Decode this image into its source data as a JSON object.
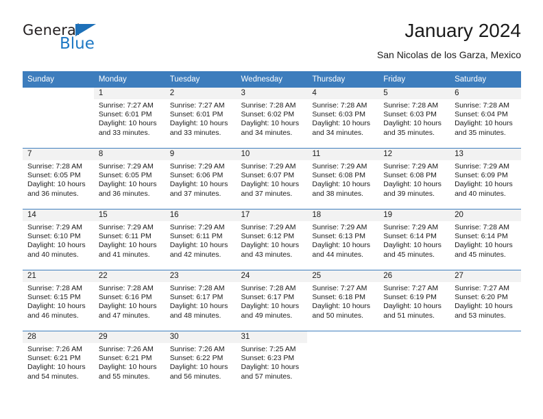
{
  "brand": {
    "name_part1": "General",
    "name_part2": "Blue"
  },
  "header": {
    "title": "January 2024",
    "subtitle": "San Nicolas de los Garza, Mexico"
  },
  "colors": {
    "header_blue": "#3d7dbd",
    "brand_blue": "#1d78c4",
    "daynum_background": "#f2f2f2",
    "text": "#1a1a1a"
  },
  "weekday_headers": [
    "Sunday",
    "Monday",
    "Tuesday",
    "Wednesday",
    "Thursday",
    "Friday",
    "Saturday"
  ],
  "labels": {
    "sunrise_prefix": "Sunrise: ",
    "sunset_prefix": "Sunset: ",
    "daylight_prefix": "Daylight: "
  },
  "weeks": [
    [
      {
        "day": "",
        "sunrise": "",
        "sunset": "",
        "daylight": "",
        "blank": true
      },
      {
        "day": "1",
        "sunrise": "Sunrise: 7:27 AM",
        "sunset": "Sunset: 6:01 PM",
        "daylight": "Daylight: 10 hours and 33 minutes."
      },
      {
        "day": "2",
        "sunrise": "Sunrise: 7:27 AM",
        "sunset": "Sunset: 6:01 PM",
        "daylight": "Daylight: 10 hours and 33 minutes."
      },
      {
        "day": "3",
        "sunrise": "Sunrise: 7:28 AM",
        "sunset": "Sunset: 6:02 PM",
        "daylight": "Daylight: 10 hours and 34 minutes."
      },
      {
        "day": "4",
        "sunrise": "Sunrise: 7:28 AM",
        "sunset": "Sunset: 6:03 PM",
        "daylight": "Daylight: 10 hours and 34 minutes."
      },
      {
        "day": "5",
        "sunrise": "Sunrise: 7:28 AM",
        "sunset": "Sunset: 6:03 PM",
        "daylight": "Daylight: 10 hours and 35 minutes."
      },
      {
        "day": "6",
        "sunrise": "Sunrise: 7:28 AM",
        "sunset": "Sunset: 6:04 PM",
        "daylight": "Daylight: 10 hours and 35 minutes."
      }
    ],
    [
      {
        "day": "7",
        "sunrise": "Sunrise: 7:28 AM",
        "sunset": "Sunset: 6:05 PM",
        "daylight": "Daylight: 10 hours and 36 minutes."
      },
      {
        "day": "8",
        "sunrise": "Sunrise: 7:29 AM",
        "sunset": "Sunset: 6:05 PM",
        "daylight": "Daylight: 10 hours and 36 minutes."
      },
      {
        "day": "9",
        "sunrise": "Sunrise: 7:29 AM",
        "sunset": "Sunset: 6:06 PM",
        "daylight": "Daylight: 10 hours and 37 minutes."
      },
      {
        "day": "10",
        "sunrise": "Sunrise: 7:29 AM",
        "sunset": "Sunset: 6:07 PM",
        "daylight": "Daylight: 10 hours and 37 minutes."
      },
      {
        "day": "11",
        "sunrise": "Sunrise: 7:29 AM",
        "sunset": "Sunset: 6:08 PM",
        "daylight": "Daylight: 10 hours and 38 minutes."
      },
      {
        "day": "12",
        "sunrise": "Sunrise: 7:29 AM",
        "sunset": "Sunset: 6:08 PM",
        "daylight": "Daylight: 10 hours and 39 minutes."
      },
      {
        "day": "13",
        "sunrise": "Sunrise: 7:29 AM",
        "sunset": "Sunset: 6:09 PM",
        "daylight": "Daylight: 10 hours and 40 minutes."
      }
    ],
    [
      {
        "day": "14",
        "sunrise": "Sunrise: 7:29 AM",
        "sunset": "Sunset: 6:10 PM",
        "daylight": "Daylight: 10 hours and 40 minutes."
      },
      {
        "day": "15",
        "sunrise": "Sunrise: 7:29 AM",
        "sunset": "Sunset: 6:11 PM",
        "daylight": "Daylight: 10 hours and 41 minutes."
      },
      {
        "day": "16",
        "sunrise": "Sunrise: 7:29 AM",
        "sunset": "Sunset: 6:11 PM",
        "daylight": "Daylight: 10 hours and 42 minutes."
      },
      {
        "day": "17",
        "sunrise": "Sunrise: 7:29 AM",
        "sunset": "Sunset: 6:12 PM",
        "daylight": "Daylight: 10 hours and 43 minutes."
      },
      {
        "day": "18",
        "sunrise": "Sunrise: 7:29 AM",
        "sunset": "Sunset: 6:13 PM",
        "daylight": "Daylight: 10 hours and 44 minutes."
      },
      {
        "day": "19",
        "sunrise": "Sunrise: 7:29 AM",
        "sunset": "Sunset: 6:14 PM",
        "daylight": "Daylight: 10 hours and 45 minutes."
      },
      {
        "day": "20",
        "sunrise": "Sunrise: 7:28 AM",
        "sunset": "Sunset: 6:14 PM",
        "daylight": "Daylight: 10 hours and 45 minutes."
      }
    ],
    [
      {
        "day": "21",
        "sunrise": "Sunrise: 7:28 AM",
        "sunset": "Sunset: 6:15 PM",
        "daylight": "Daylight: 10 hours and 46 minutes."
      },
      {
        "day": "22",
        "sunrise": "Sunrise: 7:28 AM",
        "sunset": "Sunset: 6:16 PM",
        "daylight": "Daylight: 10 hours and 47 minutes."
      },
      {
        "day": "23",
        "sunrise": "Sunrise: 7:28 AM",
        "sunset": "Sunset: 6:17 PM",
        "daylight": "Daylight: 10 hours and 48 minutes."
      },
      {
        "day": "24",
        "sunrise": "Sunrise: 7:28 AM",
        "sunset": "Sunset: 6:17 PM",
        "daylight": "Daylight: 10 hours and 49 minutes."
      },
      {
        "day": "25",
        "sunrise": "Sunrise: 7:27 AM",
        "sunset": "Sunset: 6:18 PM",
        "daylight": "Daylight: 10 hours and 50 minutes."
      },
      {
        "day": "26",
        "sunrise": "Sunrise: 7:27 AM",
        "sunset": "Sunset: 6:19 PM",
        "daylight": "Daylight: 10 hours and 51 minutes."
      },
      {
        "day": "27",
        "sunrise": "Sunrise: 7:27 AM",
        "sunset": "Sunset: 6:20 PM",
        "daylight": "Daylight: 10 hours and 53 minutes."
      }
    ],
    [
      {
        "day": "28",
        "sunrise": "Sunrise: 7:26 AM",
        "sunset": "Sunset: 6:21 PM",
        "daylight": "Daylight: 10 hours and 54 minutes."
      },
      {
        "day": "29",
        "sunrise": "Sunrise: 7:26 AM",
        "sunset": "Sunset: 6:21 PM",
        "daylight": "Daylight: 10 hours and 55 minutes."
      },
      {
        "day": "30",
        "sunrise": "Sunrise: 7:26 AM",
        "sunset": "Sunset: 6:22 PM",
        "daylight": "Daylight: 10 hours and 56 minutes."
      },
      {
        "day": "31",
        "sunrise": "Sunrise: 7:25 AM",
        "sunset": "Sunset: 6:23 PM",
        "daylight": "Daylight: 10 hours and 57 minutes."
      },
      {
        "day": "",
        "sunrise": "",
        "sunset": "",
        "daylight": "",
        "blank": true
      },
      {
        "day": "",
        "sunrise": "",
        "sunset": "",
        "daylight": "",
        "blank": true
      },
      {
        "day": "",
        "sunrise": "",
        "sunset": "",
        "daylight": "",
        "blank": true
      }
    ]
  ]
}
